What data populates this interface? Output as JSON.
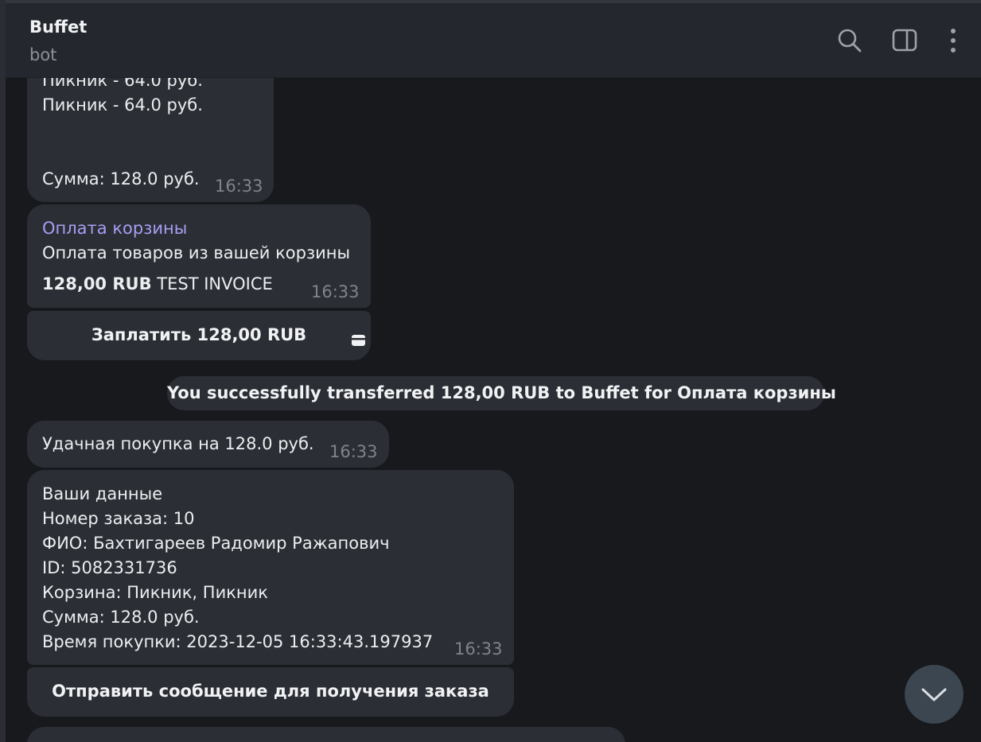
{
  "header": {
    "title": "Buffet",
    "subtitle": "bot"
  },
  "icons": {
    "search": "search-icon",
    "sidebar": "sidebar-toggle-icon",
    "menu": "more-vertical-icon",
    "card": "credit-card-icon",
    "scroll": "chevron-down-icon"
  },
  "messages": {
    "cart": {
      "line1": "Пикник - 64.0 руб.",
      "line2": "Пикник - 64.0 руб.",
      "sum": "Сумма: 128.0 руб.",
      "time": "16:33"
    },
    "invoice": {
      "title": "Оплата корзины",
      "description": "Оплата товаров из вашей корзины",
      "amount": "128,00 RUB",
      "label": "TEST INVOICE",
      "time": "16:33",
      "pay_button": "Заплатить 128,00 RUB"
    },
    "service": "You successfully transferred 128,00 RUB to Buffet for Оплата корзины",
    "success": {
      "text": "Удачная покупка на 128.0 руб.",
      "time": "16:33"
    },
    "details": {
      "lines": [
        "Ваши данные",
        "Номер заказа: 10",
        "ФИО: Бахтигареев Радомир Ражапович",
        "ID: 5082331736",
        "Корзина: Пикник, Пикник",
        "Сумма: 128.0 руб.",
        "Время покупки: 2023-12-05 16:33:43.197937"
      ],
      "time": "16:33",
      "order_button": "Отправить сообщение для получения заказа"
    }
  },
  "colors": {
    "background": "#17191d",
    "bubble": "#2b2f35",
    "header": "#24282e",
    "accent": "#a99cf2"
  }
}
